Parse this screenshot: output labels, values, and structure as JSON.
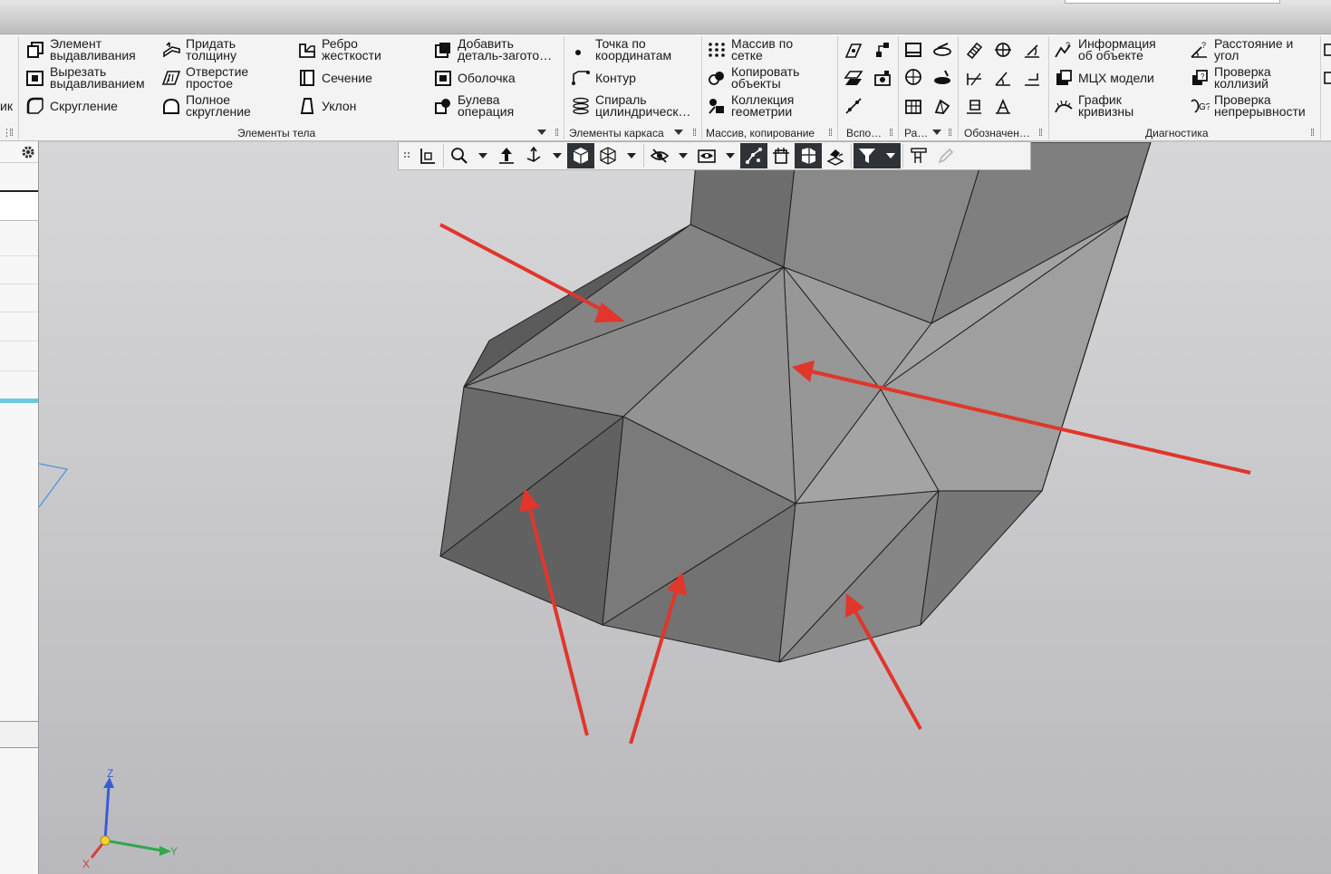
{
  "colors": {
    "accent": "#e0362c",
    "model_face": "#8c8c8c",
    "active_tool": "#2f3338"
  },
  "ribbon": {
    "left_cut_label": "ик",
    "body": {
      "extrude": "Элемент\nвыдавливания",
      "cut_extrude": "Вырезать\nвыдавливанием",
      "fillet": "Скругление",
      "thicken": "Придать\nтолщину",
      "simple_hole": "Отверстие\nпростое",
      "full_round": "Полное\nскругление",
      "rib": "Ребро\nжесткости",
      "section": "Сечение",
      "draft": "Уклон",
      "add_blank": "Добавить\nдеталь-загото…",
      "shell": "Оболочка",
      "boolean": "Булева\nоперация",
      "group_label": "Элементы тела"
    },
    "wireframe": {
      "point_coords": "Точка по\nкоординатам",
      "contour": "Контур",
      "cyl_spiral": "Спираль\nцилиндрическ…",
      "group_label": "Элементы каркаса"
    },
    "pattern": {
      "grid_pattern": "Массив по\nсетке",
      "copy_objects": "Копировать\nобъекты",
      "geometry_collection": "Коллекция\nгеометрии",
      "group_label": "Массив, копирование"
    },
    "aux_group_label": "Вспо…",
    "ra_group_label": "Ра…",
    "designations_group_label": "Обозначен…",
    "diagnostics": {
      "object_info": "Информация\nоб объекте",
      "mass_props": "МЦХ модели",
      "curvature": "График\nкривизны",
      "distance_angle": "Расстояние и\nугол",
      "collisions": "Проверка\nколлизий",
      "continuity": "Проверка\nнепрерывности",
      "group_label": "Диагностика"
    }
  },
  "axes": {
    "z": "Z",
    "y": "Y",
    "x": "X"
  }
}
